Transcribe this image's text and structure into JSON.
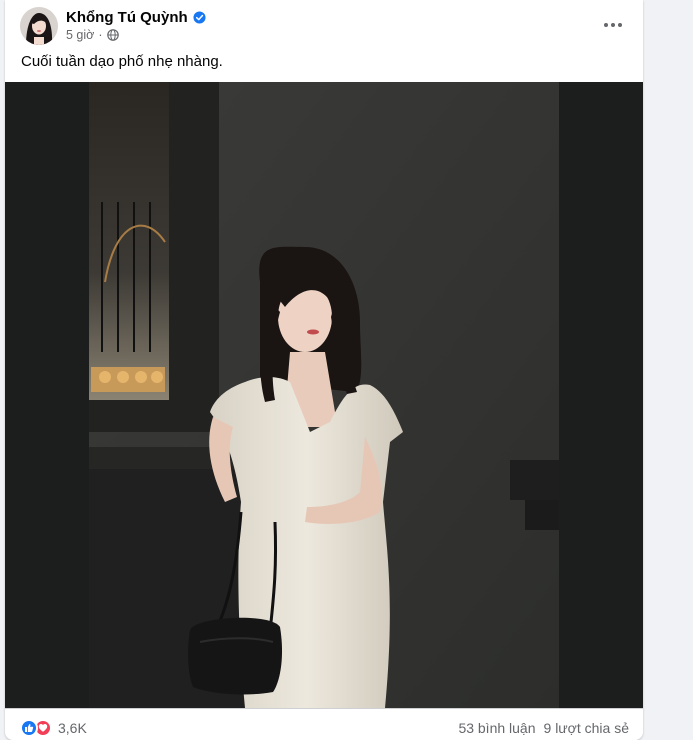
{
  "post": {
    "author": "Khổng Tú Quỳnh",
    "time": "5 giờ",
    "verified_icon": "verified-badge-icon",
    "privacy_icon": "globe-icon",
    "more_icon": "more-options-icon",
    "caption": "Cuối tuần dạo phố nhẹ nhàng."
  },
  "footer": {
    "reaction_count": "3,6K",
    "comments": "53 bình luận",
    "shares": "9 lượt chia sẻ",
    "reaction_icons": [
      "like-icon",
      "love-icon"
    ]
  },
  "colors": {
    "accent": "#1877f2",
    "love": "#f33e58",
    "secondary_text": "#65676b"
  }
}
